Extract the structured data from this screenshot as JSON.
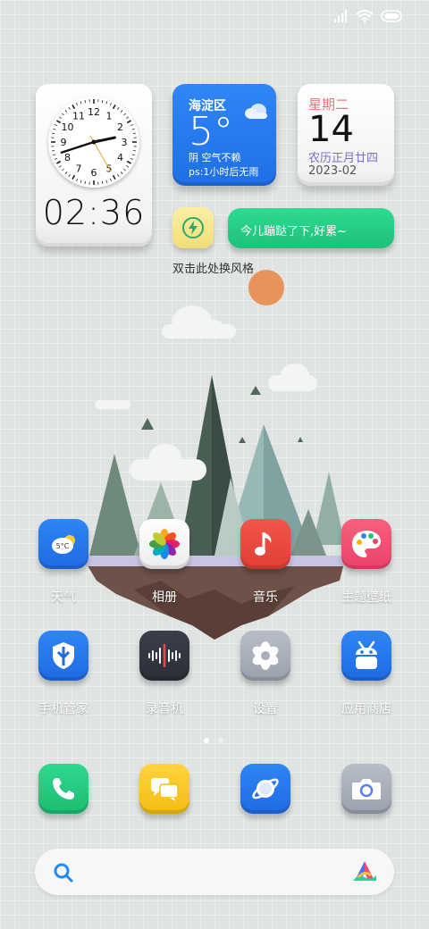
{
  "status_bar": {
    "icons": [
      "signal-icon",
      "wifi-icon",
      "battery-icon"
    ]
  },
  "clock_widget": {
    "time": "02:36",
    "dial_numbers": [
      "12",
      "1",
      "2",
      "3",
      "4",
      "5",
      "6",
      "7",
      "8",
      "9",
      "10",
      "11"
    ]
  },
  "weather_widget": {
    "city": "海淀区",
    "temperature": "5°",
    "condition": "阴  空气不赖",
    "hint": "ps:1小时后无雨",
    "icon": "cloud-icon"
  },
  "calendar_widget": {
    "weekday": "星期二",
    "day": "14",
    "lunar": "农历正月廿四",
    "month": "2023-02"
  },
  "style_switch": {
    "label": "双击此处换风格",
    "icon": "lightning-icon"
  },
  "bubble": {
    "text": "今儿蹦跶了下,好累~"
  },
  "apps_row1": [
    {
      "label": "天气",
      "icon": "weather-icon",
      "badge": "5°C"
    },
    {
      "label": "相册",
      "icon": "gallery-icon"
    },
    {
      "label": "音乐",
      "icon": "music-icon"
    },
    {
      "label": "主题壁纸",
      "icon": "palette-icon"
    }
  ],
  "apps_row2": [
    {
      "label": "手机管家",
      "icon": "shield-icon"
    },
    {
      "label": "录音机",
      "icon": "recorder-icon"
    },
    {
      "label": "设置",
      "icon": "settings-icon"
    },
    {
      "label": "应用商店",
      "icon": "app-store-icon"
    }
  ],
  "page_indicator": {
    "current": 1,
    "total": 2
  },
  "dock": [
    {
      "icon": "phone-icon"
    },
    {
      "icon": "messages-icon"
    },
    {
      "icon": "browser-icon"
    },
    {
      "icon": "camera-icon"
    }
  ],
  "search": {
    "icon": "search-icon",
    "assistant_icon": "assistant-icon"
  },
  "colors": {
    "background": "#dfe3e1",
    "weather_blue": "#2f86f6",
    "bubble_green": "#1fc07a",
    "calendar_red": "#e5787a",
    "lunar_purple": "#7770c9"
  }
}
